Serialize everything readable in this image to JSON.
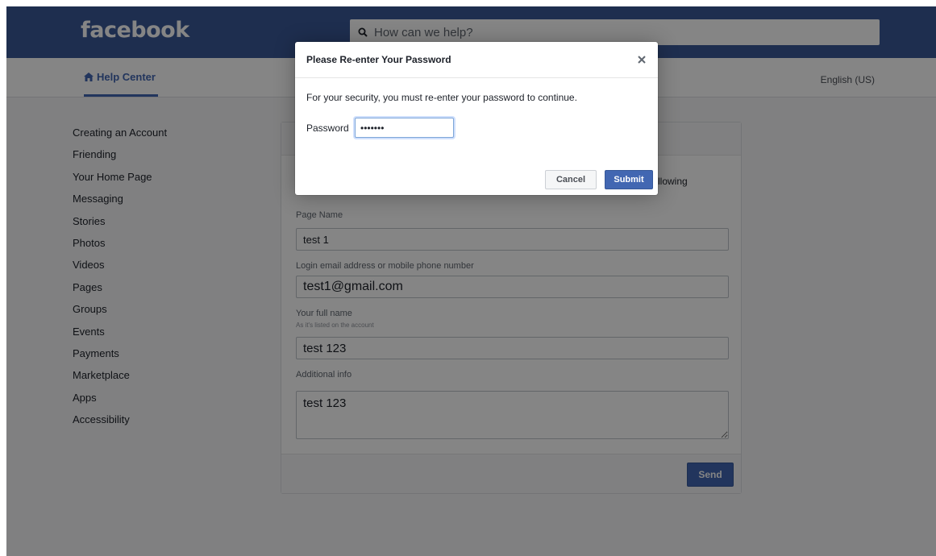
{
  "header": {
    "logo": "facebook",
    "search_placeholder": "How can we help?"
  },
  "subnav": {
    "help_center": "Help Center",
    "language": "English (US)"
  },
  "sidebar": {
    "items": [
      {
        "label": "Creating an Account"
      },
      {
        "label": "Friending"
      },
      {
        "label": "Your Home Page"
      },
      {
        "label": "Messaging"
      },
      {
        "label": "Stories"
      },
      {
        "label": "Photos"
      },
      {
        "label": "Videos"
      },
      {
        "label": "Pages"
      },
      {
        "label": "Groups"
      },
      {
        "label": "Events"
      },
      {
        "label": "Payments"
      },
      {
        "label": "Marketplace"
      },
      {
        "label": "Apps"
      },
      {
        "label": "Accessibility"
      }
    ]
  },
  "form": {
    "intro_tail": "llowing",
    "page_name_label": "Page Name",
    "page_name_value": "test 1",
    "login_label": "Login email address or mobile phone number",
    "login_value": "test1@gmail.com",
    "full_name_label": "Your full name",
    "full_name_hint": "As it's listed on the account",
    "full_name_value": "test 123",
    "additional_label": "Additional info",
    "additional_value": "test 123",
    "send_label": "Send"
  },
  "modal": {
    "title": "Please Re-enter Your Password",
    "message": "For your security, you must re-enter your password to continue.",
    "password_label": "Password",
    "password_value": "•••••••",
    "cancel_label": "Cancel",
    "submit_label": "Submit"
  },
  "colors": {
    "brand": "#3b5998",
    "button": "#4267b2"
  }
}
